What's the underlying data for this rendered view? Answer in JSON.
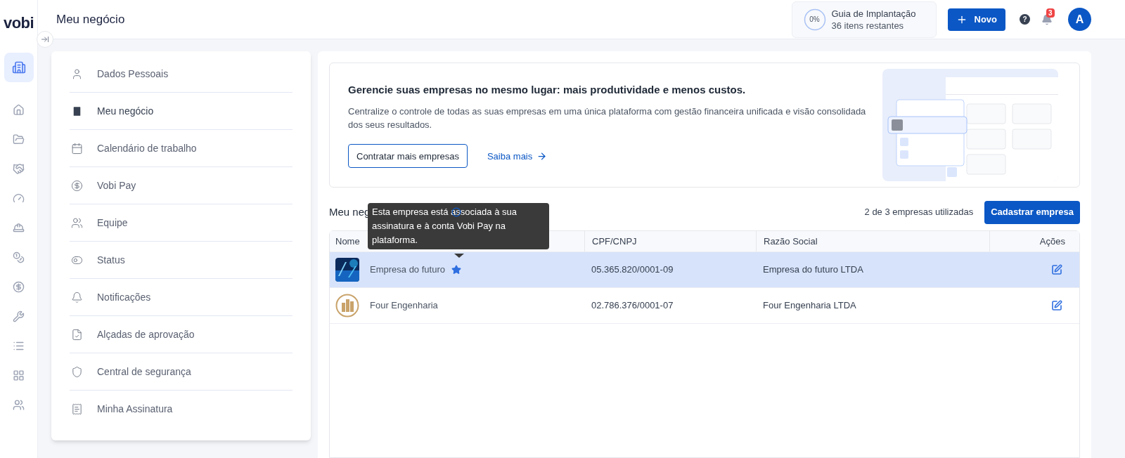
{
  "logo": "vobi",
  "rail": [
    {
      "selected": true
    },
    {
      "selected": false
    },
    {
      "selected": false
    },
    {
      "selected": false
    },
    {
      "selected": false
    },
    {
      "selected": false
    },
    {
      "selected": false
    },
    {
      "selected": false
    },
    {
      "selected": false
    },
    {
      "selected": false
    },
    {
      "selected": false
    },
    {
      "selected": false
    }
  ],
  "page_title": "Meu negócio",
  "guide": {
    "percent": "0%",
    "title": "Guia de Implantação",
    "subtitle": "36 itens restantes"
  },
  "new_button": "Novo",
  "help": "?",
  "notifications": "3",
  "avatar": "A",
  "settings_menu": [
    {
      "label": "Dados Pessoais",
      "selected": false
    },
    {
      "label": "Meu negócio",
      "selected": true
    },
    {
      "label": "Calendário de trabalho",
      "selected": false
    },
    {
      "label": "Vobi Pay",
      "selected": false
    },
    {
      "label": "Equipe",
      "selected": false
    },
    {
      "label": "Status",
      "selected": false
    },
    {
      "label": "Notificações",
      "selected": false
    },
    {
      "label": "Alçadas de aprovação",
      "selected": false
    },
    {
      "label": "Central de segurança",
      "selected": false
    },
    {
      "label": "Minha Assinatura",
      "selected": false
    }
  ],
  "promo": {
    "title": "Gerencie suas empresas no mesmo lugar: mais produtividade e menos custos.",
    "text": "Centralize o controle de todas as suas empresas em uma única plataforma com gestão financeira unificada e visão consolidada dos seus resultados.",
    "primary": "Contratar mais empresas",
    "link": "Saiba mais"
  },
  "section": {
    "title": "Meu neg",
    "usage": "2 de 3 empresas utilizadas",
    "add_button": "Cadastrar empresa"
  },
  "tooltip": "Esta empresa está associada à sua assinatura e à conta Vobi Pay na plataforma.",
  "table": {
    "columns": [
      "Nome",
      "CPF/CNPJ",
      "Razão Social",
      "Ações"
    ],
    "rows": [
      {
        "name": "Empresa do futuro",
        "main": true,
        "document": "05.365.820/0001-09",
        "company": "Empresa do futuro LTDA",
        "selected": true
      },
      {
        "name": "Four Engenharia",
        "main": false,
        "document": "02.786.376/0001-07",
        "company": "Four Engenharia LTDA",
        "selected": false
      }
    ]
  }
}
